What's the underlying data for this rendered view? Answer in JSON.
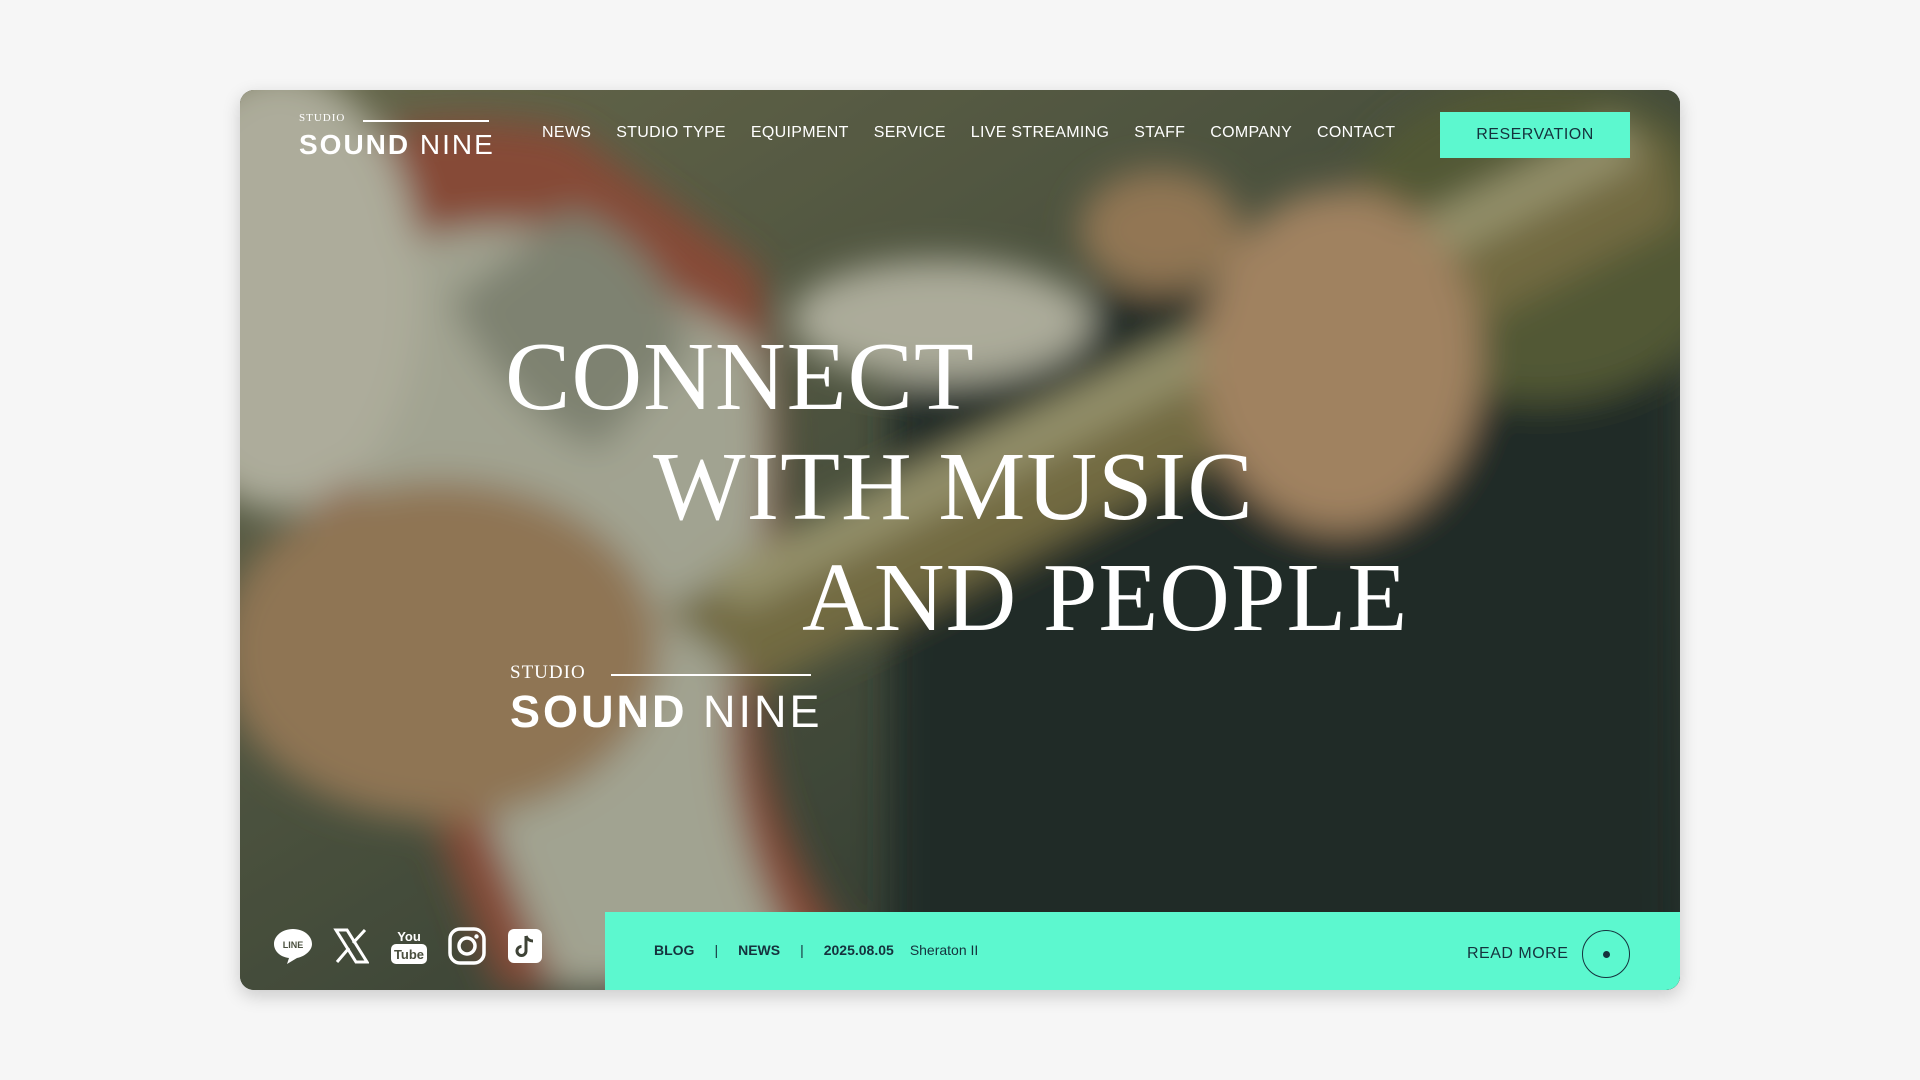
{
  "header": {
    "logo": {
      "studio": "STUDIO",
      "name_bold": "SOUND",
      "name_light": "NINE"
    },
    "nav": [
      "NEWS",
      "STUDIO TYPE",
      "EQUIPMENT",
      "SERVICE",
      "LIVE STREAMING",
      "STAFF",
      "COMPANY",
      "CONTACT"
    ],
    "reservation_label": "RESERVATION"
  },
  "hero": {
    "headline": [
      "CONNECT",
      "WITH MUSIC",
      "AND PEOPLE"
    ],
    "logo": {
      "studio": "STUDIO",
      "name_bold": "SOUND",
      "name_light": "NINE"
    },
    "background_image": "close-up of guitarist playing a red and white electric guitar"
  },
  "social": [
    "line-icon",
    "x-icon",
    "youtube-icon",
    "instagram-icon",
    "tiktok-icon"
  ],
  "news": {
    "category1": "BLOG",
    "separator": "|",
    "category2": "NEWS",
    "date": "2025.08.05",
    "title": "Sheraton II",
    "read_more": "READ MORE"
  },
  "colors": {
    "accent": "#5cf8cf",
    "dark_text": "#15323d",
    "page_bg": "#f6f6f6"
  }
}
